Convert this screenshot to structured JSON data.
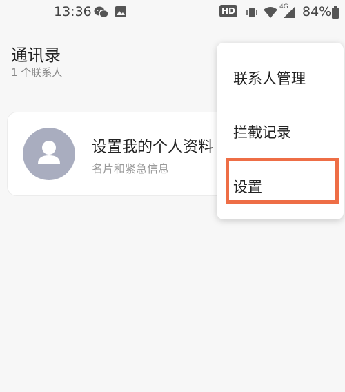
{
  "status_bar": {
    "time": "13:36",
    "hd_badge": "HD",
    "network": "4G",
    "battery_text": "84%",
    "icons": [
      "wechat-icon",
      "image-icon",
      "vibrate-icon",
      "wifi-icon",
      "signal-icon",
      "battery-icon"
    ]
  },
  "header": {
    "title": "通讯录",
    "subtitle": "1 个联系人"
  },
  "profile_card": {
    "title": "设置我的个人资料",
    "subtitle": "名片和紧急信息"
  },
  "popup_menu": {
    "items": [
      {
        "label": "联系人管理"
      },
      {
        "label": "拦截记录"
      },
      {
        "label": "设置"
      }
    ],
    "highlight_color": "#ee6e46"
  },
  "colors": {
    "avatar": "#a9adbf",
    "background": "#f7f7f7"
  }
}
